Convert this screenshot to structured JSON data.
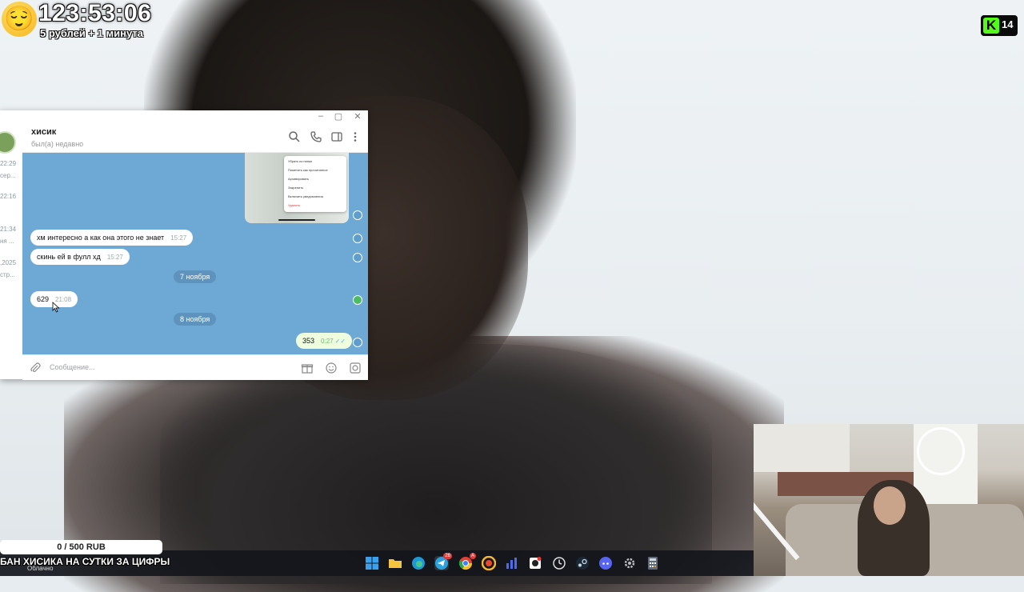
{
  "overlay": {
    "timer": "123:53:06",
    "timer_rate": "5 рублей + 1 минута",
    "emoji_icon": "relieved-face-emoji",
    "kick_viewers": "14",
    "kick_logo_letter": "K",
    "kick_color": "#53fc18"
  },
  "telegram": {
    "chat_name": "хисик",
    "chat_status": "был(а) недавно",
    "input_placeholder": "Сообщение...",
    "left_stubs": [
      "22:29",
      "сер...",
      "22:16",
      "21:34",
      "ня ...",
      ",2025",
      "стр..."
    ],
    "messages": [
      {
        "text": "хм интересно а как она этого не знает",
        "time": "15:27",
        "outgoing": false
      },
      {
        "text": "скинь ей в фулл хд",
        "time": "15:27",
        "outgoing": false
      },
      {
        "text": "629",
        "time": "21:08",
        "outgoing": false
      },
      {
        "text": "353",
        "time": "0:27",
        "outgoing": true
      }
    ],
    "dates": [
      "7 ноября",
      "8 ноября"
    ],
    "context_menu": [
      "Убрать из папки",
      "Пометить как прочитанное",
      "Архивировать",
      "Закрепить",
      "Включить уведомления",
      "Удалить"
    ],
    "chat_bg_color": "#6ea9d6"
  },
  "donation": {
    "progress_text": "0 / 500 RUB",
    "progress_fraction": 0,
    "caption": "БАН ХИСИКА НА СУТКИ ЗА ЦИФРЫ",
    "weather": "Облачно"
  },
  "taskbar": {
    "icons": [
      "windows-start-icon",
      "file-explorer-icon",
      "edge-icon",
      "telegram-icon",
      "chrome-icon",
      "yandex-browser-icon",
      "stats-app-icon",
      "obs-icon",
      "clock-app-icon",
      "steam-icon",
      "discord-icon",
      "settings-icon",
      "calculator-icon"
    ],
    "telegram_badge": "26",
    "chrome_badge": "A"
  }
}
